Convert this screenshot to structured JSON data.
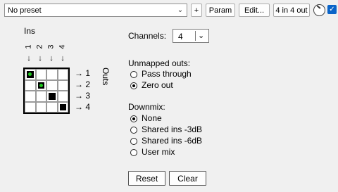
{
  "toolbar": {
    "preset_value": "No preset",
    "add_label": "+",
    "param_label": "Param",
    "edit_label": "Edit...",
    "io_label": "4 in 4 out",
    "knob_icon": "knob-icon",
    "checkbox_icon": "checkmark-icon",
    "accent_color": "#0a64c8"
  },
  "routing": {
    "ins_label": "Ins",
    "outs_label": "Outs",
    "input_numbers": [
      "1",
      "2",
      "3",
      "4"
    ],
    "output_numbers": [
      "1",
      "2",
      "3",
      "4"
    ],
    "arrow_down": "↓",
    "arrow_right": "→",
    "matrix": [
      [
        1,
        0,
        0,
        0
      ],
      [
        0,
        1,
        0,
        0
      ],
      [
        0,
        0,
        1,
        0
      ],
      [
        0,
        0,
        0,
        1
      ]
    ],
    "selected_cells": [
      [
        0,
        0
      ],
      [
        1,
        1
      ]
    ],
    "selected_marker_color": "#1ec81e"
  },
  "settings": {
    "channels_label": "Channels:",
    "channels_value": "4",
    "unmapped_label": "Unmapped outs:",
    "unmapped_options": [
      "Pass through",
      "Zero out"
    ],
    "unmapped_selected": "Zero out",
    "downmix_label": "Downmix:",
    "downmix_options": [
      "None",
      "Shared ins -3dB",
      "Shared ins -6dB",
      "User mix"
    ],
    "downmix_selected": "None"
  },
  "buttons": {
    "reset_label": "Reset",
    "clear_label": "Clear"
  }
}
